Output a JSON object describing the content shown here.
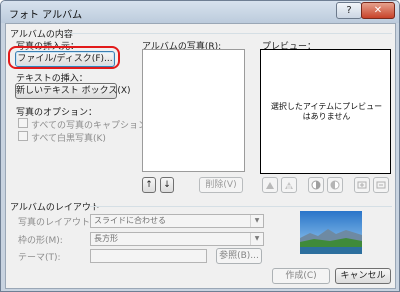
{
  "window": {
    "title": "フォト アルバム",
    "help": "?",
    "close": "✕"
  },
  "album_content": {
    "heading": "アルバムの内容",
    "insert_photo_label": "写真の挿入元：",
    "file_disk_button": "ファイル/ディスク(F)...",
    "insert_text_label": "テキストの挿入：",
    "new_textbox_button": "新しいテキスト ボックス(X)",
    "photo_options_label": "写真のオプション：",
    "caption_checkbox": "すべての写真のキャプション(A)",
    "bw_checkbox": "すべて白黒写真(K)"
  },
  "album_photos": {
    "label": "アルバムの写真(R):"
  },
  "preview": {
    "label": "プレビュー：",
    "message": "選択したアイテムにプレビューはありません"
  },
  "list_buttons": {
    "up": "↑",
    "down": "↓",
    "delete": "削除(V)"
  },
  "preview_tool_icons": [
    "rotate-left-icon",
    "rotate-right-icon",
    "contrast-up-icon",
    "contrast-down-icon",
    "brightness-up-icon",
    "brightness-down-icon"
  ],
  "album_layout": {
    "heading": "アルバムのレイアウト",
    "picture_layout_label": "写真のレイアウト(P):",
    "picture_layout_value": "スライドに合わせる",
    "frame_shape_label": "枠の形(M):",
    "frame_shape_value": "長方形",
    "theme_label": "テーマ(T):",
    "theme_value": "",
    "browse_button": "参照(B)..."
  },
  "footer": {
    "create_button": "作成(C)",
    "cancel_button": "キャンセル"
  }
}
